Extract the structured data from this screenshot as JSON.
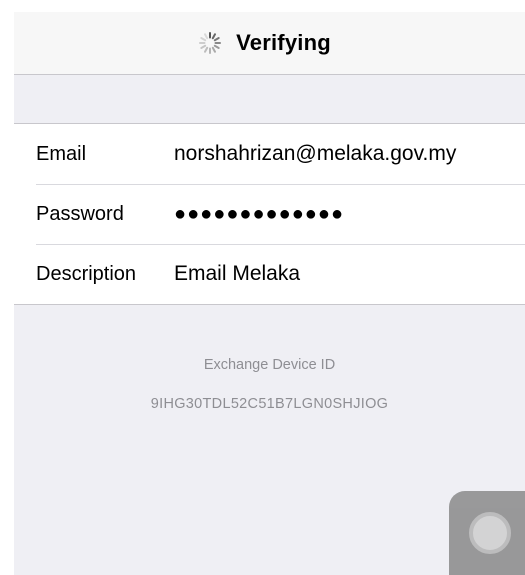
{
  "navbar": {
    "title": "Verifying",
    "spinner_icon": "activity-spinner-icon"
  },
  "form": {
    "rows": [
      {
        "label": "Email",
        "value": "norshahrizan@melaka.gov.my"
      },
      {
        "label": "Password",
        "value": "●●●●●●●●●●●●●"
      },
      {
        "label": "Description",
        "value": "Email Melaka"
      }
    ]
  },
  "device": {
    "title": "Exchange Device ID",
    "id": "9IHG30TDL52C51B7LGN0SHJIOG"
  },
  "assistive_touch": {
    "icon": "assistive-touch-icon"
  },
  "colors": {
    "background": "#efeff4",
    "separator": "#c8c7cc",
    "secondary_text": "#8e8e93"
  }
}
